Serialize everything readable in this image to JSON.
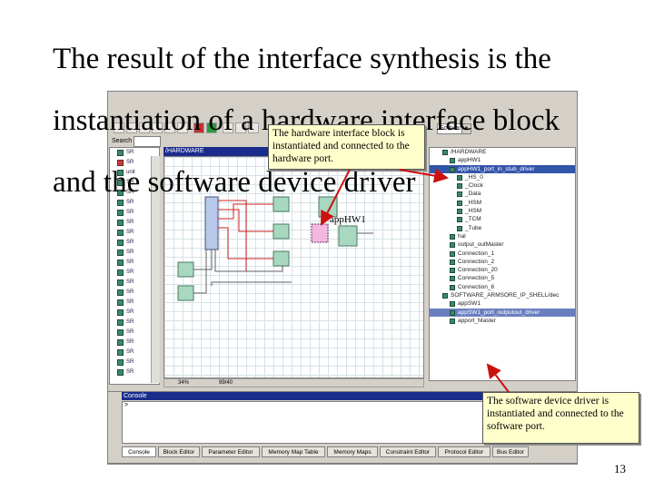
{
  "slide": {
    "title_lines": [
      "The result of the interface synthesis is the",
      "instantiation of a hardware interface block",
      "and the software device driver"
    ],
    "page_number": "13"
  },
  "app": {
    "toolbar": {
      "view_select_value": "Software"
    },
    "search_label": "Search",
    "hardware_panel_title": "/HARDWARE",
    "canvas_status": {
      "zoom": "34%",
      "coords": "99/40"
    },
    "left_tree_items": [
      "SR",
      "SR",
      "unit",
      "SR",
      "SR",
      "SR",
      "SR",
      "SR",
      "SR",
      "SR",
      "SR",
      "SR",
      "SR",
      "SR",
      "SR",
      "SR",
      "SR",
      "SR",
      "SR",
      "SR",
      "SR",
      "SR",
      "SR"
    ],
    "right_tree_items": [
      {
        "label": "/HARDWARE",
        "indent": 1,
        "state": ""
      },
      {
        "label": "appHW1",
        "indent": 2,
        "state": ""
      },
      {
        "label": "appHW1_port_in_stub_driver",
        "indent": 2,
        "state": "sel"
      },
      {
        "label": "_HS_0",
        "indent": 3,
        "state": ""
      },
      {
        "label": "_Clock",
        "indent": 3,
        "state": ""
      },
      {
        "label": "_Data",
        "indent": 3,
        "state": ""
      },
      {
        "label": "_HSM",
        "indent": 3,
        "state": ""
      },
      {
        "label": "_HSM",
        "indent": 3,
        "state": ""
      },
      {
        "label": "_TCM",
        "indent": 3,
        "state": ""
      },
      {
        "label": "_Tube",
        "indent": 3,
        "state": ""
      },
      {
        "label": "hal",
        "indent": 2,
        "state": ""
      },
      {
        "label": "output_outMaster",
        "indent": 2,
        "state": ""
      },
      {
        "label": "Connection_1",
        "indent": 2,
        "state": ""
      },
      {
        "label": "Connection_2",
        "indent": 2,
        "state": ""
      },
      {
        "label": "Connection_20",
        "indent": 2,
        "state": ""
      },
      {
        "label": "Connection_5",
        "indent": 2,
        "state": ""
      },
      {
        "label": "Connection_6",
        "indent": 2,
        "state": ""
      },
      {
        "label": "SOFTWARE_ARMSORE_IP_SHELL/dec",
        "indent": 1,
        "state": ""
      },
      {
        "label": "appSW1",
        "indent": 2,
        "state": ""
      },
      {
        "label": "appSW1_port_outputout_driver",
        "indent": 2,
        "state": "sel2"
      },
      {
        "label": "apport_Master",
        "indent": 2,
        "state": ""
      }
    ],
    "console": {
      "title": "Console",
      "prompt": ">",
      "tabs": [
        "Console",
        "Block Editor",
        "Parameter Editor",
        "Memory Map Table",
        "Memory Maps",
        "Constraint Editor",
        "Protocol Editor",
        "Bus Editor"
      ]
    }
  },
  "annotations": {
    "hw_callout": "The hardware interface block is instantiated and connected to the hardware port.",
    "sw_callout": "The software device driver is instantiated and connected to the software port.",
    "app_hw_label": "appHW1"
  },
  "colors": {
    "panel_title_bg": "#1a2c8c",
    "callout_bg": "#ffffcc",
    "arrow": "#cc1010",
    "block_fill": "#a8d8c0",
    "selection": "#3355aa"
  }
}
